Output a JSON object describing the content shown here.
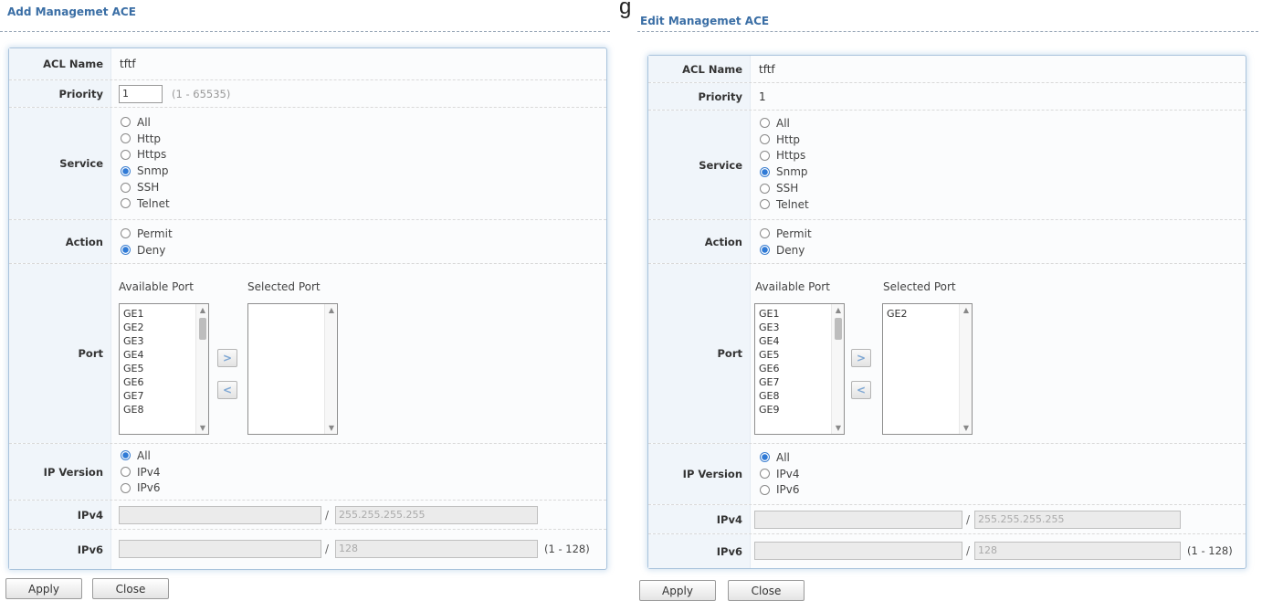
{
  "stray_glyph": "g",
  "add_form": {
    "title": "Add Managemet ACE",
    "labels": {
      "acl_name": "ACL Name",
      "priority": "Priority",
      "service": "Service",
      "action": "Action",
      "port": "Port",
      "ip_version": "IP Version",
      "ipv4": "IPv4",
      "ipv6": "IPv6"
    },
    "acl_name": "tftf",
    "priority_value": "1",
    "priority_hint": "(1 - 65535)",
    "service_options": [
      "All",
      "Http",
      "Https",
      "Snmp",
      "SSH",
      "Telnet"
    ],
    "service_selected": "Snmp",
    "action_options": [
      "Permit",
      "Deny"
    ],
    "action_selected": "Deny",
    "available_port_header": "Available Port",
    "selected_port_header": "Selected Port",
    "available_ports": [
      "GE1",
      "GE2",
      "GE3",
      "GE4",
      "GE5",
      "GE6",
      "GE7",
      "GE8"
    ],
    "selected_ports": [],
    "move_right_icon": "chevron-right-icon",
    "move_left_icon": "chevron-left-icon",
    "ip_version_options": [
      "All",
      "IPv4",
      "IPv6"
    ],
    "ip_version_selected": "All",
    "ipv4_address": "",
    "ipv4_mask_placeholder": "255.255.255.255",
    "ipv6_address": "",
    "ipv6_prefix_placeholder": "128",
    "ipv6_hint": "(1 - 128)",
    "slash": "/",
    "apply_label": "Apply",
    "close_label": "Close"
  },
  "edit_form": {
    "title": "Edit Managemet ACE",
    "labels": {
      "acl_name": "ACL Name",
      "priority": "Priority",
      "service": "Service",
      "action": "Action",
      "port": "Port",
      "ip_version": "IP Version",
      "ipv4": "IPv4",
      "ipv6": "IPv6"
    },
    "acl_name": "tftf",
    "priority_value": "1",
    "service_options": [
      "All",
      "Http",
      "Https",
      "Snmp",
      "SSH",
      "Telnet"
    ],
    "service_selected": "Snmp",
    "action_options": [
      "Permit",
      "Deny"
    ],
    "action_selected": "Deny",
    "available_port_header": "Available Port",
    "selected_port_header": "Selected Port",
    "available_ports": [
      "GE1",
      "GE3",
      "GE4",
      "GE5",
      "GE6",
      "GE7",
      "GE8",
      "GE9"
    ],
    "selected_ports": [
      "GE2"
    ],
    "move_right_icon": "chevron-right-icon",
    "move_left_icon": "chevron-left-icon",
    "ip_version_options": [
      "All",
      "IPv4",
      "IPv6"
    ],
    "ip_version_selected": "All",
    "ipv4_address": "",
    "ipv4_mask_placeholder": "255.255.255.255",
    "ipv6_address": "",
    "ipv6_prefix_placeholder": "128",
    "ipv6_hint": "(1 - 128)",
    "slash": "/",
    "apply_label": "Apply",
    "close_label": "Close"
  },
  "colors": {
    "title": "#3a6ea5",
    "label_bg": "#f0f5fa",
    "panel_border": "#a9c3dc",
    "radio_checked": "#2f7ad6"
  }
}
